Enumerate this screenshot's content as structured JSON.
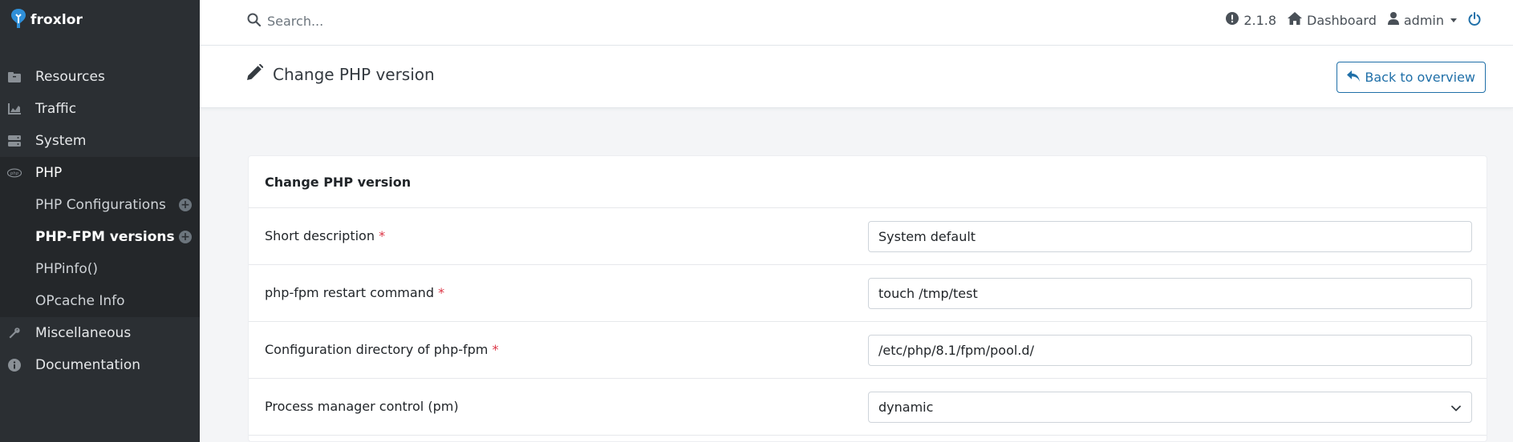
{
  "brand": {
    "name": "froxlor"
  },
  "sidebar": {
    "items": [
      {
        "label": "Resources",
        "icon": "folder-icon"
      },
      {
        "label": "Traffic",
        "icon": "chart-area-icon"
      },
      {
        "label": "System",
        "icon": "server-icon"
      },
      {
        "label": "PHP",
        "icon": "php-icon"
      },
      {
        "label": "Miscellaneous",
        "icon": "wrench-icon"
      },
      {
        "label": "Documentation",
        "icon": "info-circle-icon"
      }
    ],
    "php_subitems": [
      {
        "label": "PHP Configurations"
      },
      {
        "label": "PHP-FPM versions"
      },
      {
        "label": "PHPinfo()"
      },
      {
        "label": "OPcache Info"
      }
    ]
  },
  "topbar": {
    "search_placeholder": "Search...",
    "version": "2.1.8",
    "dashboard": "Dashboard",
    "user": "admin"
  },
  "page": {
    "title": "Change PHP version",
    "back_label": "Back to overview"
  },
  "card": {
    "title": "Change PHP version",
    "required_mark": "*",
    "fields": [
      {
        "label": "Short description",
        "value": "System default",
        "required": true
      },
      {
        "label": "php-fpm restart command",
        "value": "touch /tmp/test",
        "required": true
      },
      {
        "label": "Configuration directory of php-fpm",
        "value": "/etc/php/8.1/fpm/pool.d/",
        "required": true
      },
      {
        "label": "Process manager control (pm)",
        "value": "dynamic",
        "required": false
      }
    ]
  },
  "colors": {
    "sidebar_bg": "#2b2f33",
    "accent": "#1f6fa8",
    "required": "#dc3545"
  }
}
